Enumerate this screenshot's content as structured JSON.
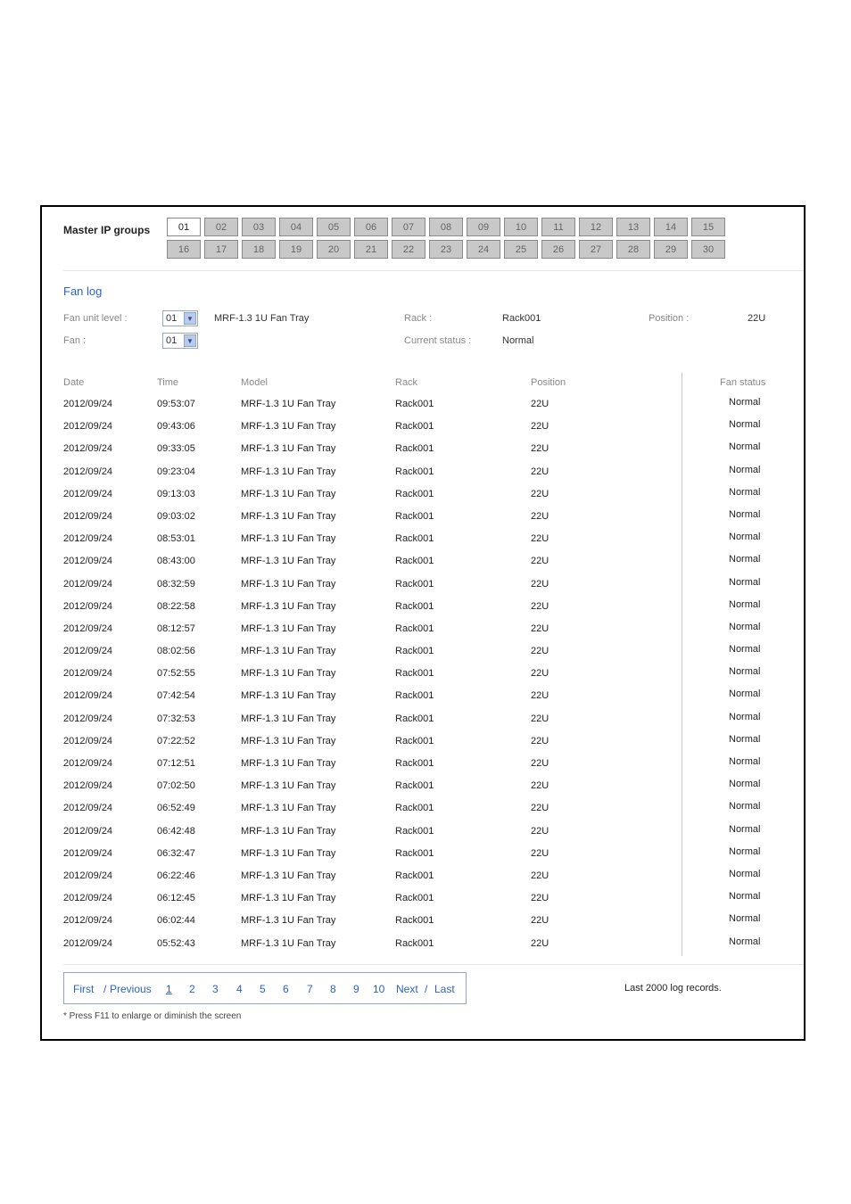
{
  "master_ip_groups": {
    "label": "Master IP groups",
    "active": "01",
    "buttons": [
      "01",
      "02",
      "03",
      "04",
      "05",
      "06",
      "07",
      "08",
      "09",
      "10",
      "11",
      "12",
      "13",
      "14",
      "15",
      "16",
      "17",
      "18",
      "19",
      "20",
      "21",
      "22",
      "23",
      "24",
      "25",
      "26",
      "27",
      "28",
      "29",
      "30"
    ]
  },
  "fan_log": {
    "title": "Fan log",
    "fan_unit_level_label": "Fan unit level :",
    "fan_unit_level_value": "01",
    "model_value": "MRF-1.3 1U Fan Tray",
    "fan_label": "Fan :",
    "fan_value": "01",
    "rack_label": "Rack :",
    "rack_value": "Rack001",
    "current_status_label": "Current status :",
    "current_status_value": "Normal",
    "position_label": "Position :",
    "position_value": "22U"
  },
  "table": {
    "headers": [
      "Date",
      "Time",
      "Model",
      "Rack",
      "Position",
      "Fan status"
    ],
    "rows": [
      [
        "2012/09/24",
        "09:53:07",
        "MRF-1.3 1U Fan Tray",
        "Rack001",
        "22U",
        "Normal"
      ],
      [
        "2012/09/24",
        "09:43:06",
        "MRF-1.3 1U Fan Tray",
        "Rack001",
        "22U",
        "Normal"
      ],
      [
        "2012/09/24",
        "09:33:05",
        "MRF-1.3 1U Fan Tray",
        "Rack001",
        "22U",
        "Normal"
      ],
      [
        "2012/09/24",
        "09:23:04",
        "MRF-1.3 1U Fan Tray",
        "Rack001",
        "22U",
        "Normal"
      ],
      [
        "2012/09/24",
        "09:13:03",
        "MRF-1.3 1U Fan Tray",
        "Rack001",
        "22U",
        "Normal"
      ],
      [
        "2012/09/24",
        "09:03:02",
        "MRF-1.3 1U Fan Tray",
        "Rack001",
        "22U",
        "Normal"
      ],
      [
        "2012/09/24",
        "08:53:01",
        "MRF-1.3 1U Fan Tray",
        "Rack001",
        "22U",
        "Normal"
      ],
      [
        "2012/09/24",
        "08:43:00",
        "MRF-1.3 1U Fan Tray",
        "Rack001",
        "22U",
        "Normal"
      ],
      [
        "2012/09/24",
        "08:32:59",
        "MRF-1.3 1U Fan Tray",
        "Rack001",
        "22U",
        "Normal"
      ],
      [
        "2012/09/24",
        "08:22:58",
        "MRF-1.3 1U Fan Tray",
        "Rack001",
        "22U",
        "Normal"
      ],
      [
        "2012/09/24",
        "08:12:57",
        "MRF-1.3 1U Fan Tray",
        "Rack001",
        "22U",
        "Normal"
      ],
      [
        "2012/09/24",
        "08:02:56",
        "MRF-1.3 1U Fan Tray",
        "Rack001",
        "22U",
        "Normal"
      ],
      [
        "2012/09/24",
        "07:52:55",
        "MRF-1.3 1U Fan Tray",
        "Rack001",
        "22U",
        "Normal"
      ],
      [
        "2012/09/24",
        "07:42:54",
        "MRF-1.3 1U Fan Tray",
        "Rack001",
        "22U",
        "Normal"
      ],
      [
        "2012/09/24",
        "07:32:53",
        "MRF-1.3 1U Fan Tray",
        "Rack001",
        "22U",
        "Normal"
      ],
      [
        "2012/09/24",
        "07:22:52",
        "MRF-1.3 1U Fan Tray",
        "Rack001",
        "22U",
        "Normal"
      ],
      [
        "2012/09/24",
        "07:12:51",
        "MRF-1.3 1U Fan Tray",
        "Rack001",
        "22U",
        "Normal"
      ],
      [
        "2012/09/24",
        "07:02:50",
        "MRF-1.3 1U Fan Tray",
        "Rack001",
        "22U",
        "Normal"
      ],
      [
        "2012/09/24",
        "06:52:49",
        "MRF-1.3 1U Fan Tray",
        "Rack001",
        "22U",
        "Normal"
      ],
      [
        "2012/09/24",
        "06:42:48",
        "MRF-1.3 1U Fan Tray",
        "Rack001",
        "22U",
        "Normal"
      ],
      [
        "2012/09/24",
        "06:32:47",
        "MRF-1.3 1U Fan Tray",
        "Rack001",
        "22U",
        "Normal"
      ],
      [
        "2012/09/24",
        "06:22:46",
        "MRF-1.3 1U Fan Tray",
        "Rack001",
        "22U",
        "Normal"
      ],
      [
        "2012/09/24",
        "06:12:45",
        "MRF-1.3 1U Fan Tray",
        "Rack001",
        "22U",
        "Normal"
      ],
      [
        "2012/09/24",
        "06:02:44",
        "MRF-1.3 1U Fan Tray",
        "Rack001",
        "22U",
        "Normal"
      ],
      [
        "2012/09/24",
        "05:52:43",
        "MRF-1.3 1U Fan Tray",
        "Rack001",
        "22U",
        "Normal"
      ]
    ]
  },
  "pagination": {
    "first_label": "First",
    "separator": "/",
    "previous_label": "Previous",
    "pages": [
      "1",
      "2",
      "3",
      "4",
      "5",
      "6",
      "7",
      "8",
      "9",
      "10"
    ],
    "current_page": "1",
    "next_label": "Next",
    "last_label": "Last"
  },
  "last_records_text": "Last 2000 log records.",
  "footnote": "* Press F11 to enlarge or diminish the screen",
  "colors": {
    "link": "#2b63c0",
    "inactive_button": "#c8c8c8",
    "border": "#8fa6cc"
  },
  "icons": {
    "dropdown": "chevron-down-icon"
  }
}
